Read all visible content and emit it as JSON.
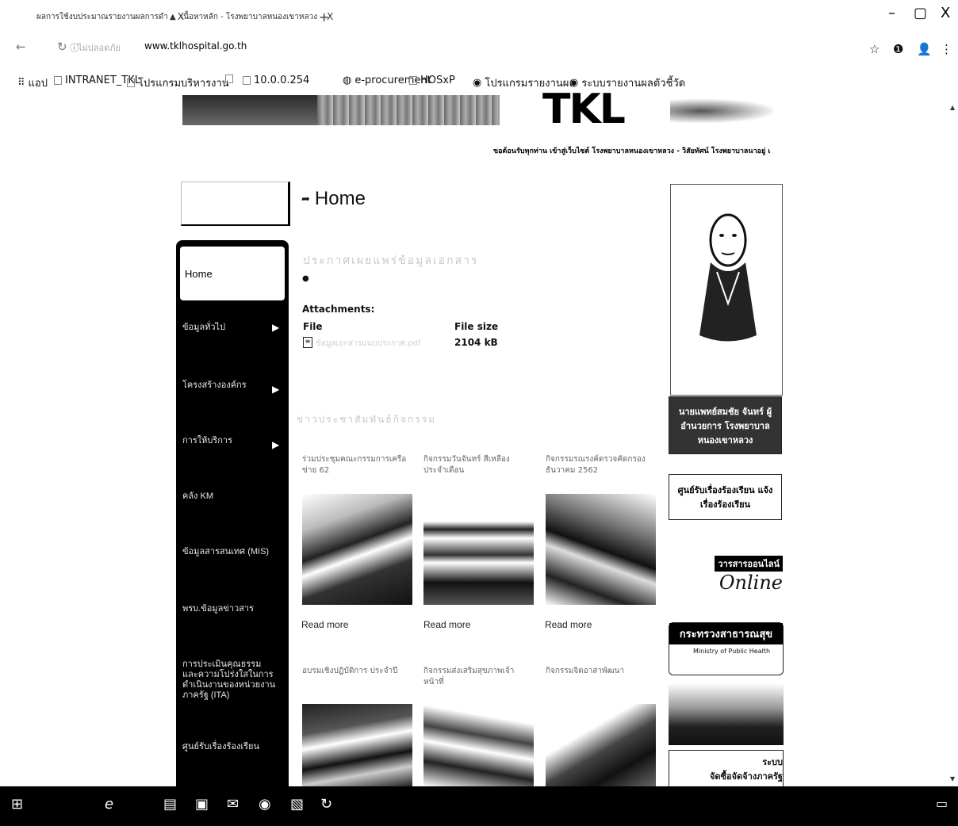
{
  "browser": {
    "tabs": [
      {
        "title": "ผลการใช้งบประมาณรายงานผลการดำ"
      },
      {
        "title": "เนื้อหาหลัก - โรงพยาบาลหนองเขาหลวง"
      }
    ],
    "new_tab_label": "+",
    "close_label": "X",
    "window": {
      "minimize": "–",
      "maximize": "▢",
      "close": "X"
    },
    "url_prefix": "ไม่ปลอดภัย",
    "url": "www.tklhospital.go.th",
    "bookmarks": [
      "แอป",
      "INTRANET_TKL",
      "โปรแกรมบริหารงาน",
      "",
      "10.0.0.254",
      "e-procurement",
      "HOSxP",
      "โปรแกรมรายงานผล",
      "ระบบรายงานผลตัวชี้วัด"
    ],
    "icons": {
      "star": "☆",
      "extension": "❶",
      "profile": "👤",
      "menu": "⋮"
    }
  },
  "header": {
    "logo_letters": "TKL",
    "marquee": "ขอต้อนรับทุกท่าน เข้าสู่เว็บไซต์ โรงพยาบาลหนองเขาหลวง - วิสัยทัศน์ โรงพยาบาลนาอยู่ เ"
  },
  "sidebar": {
    "active": "Home",
    "items": [
      {
        "label": "ข้อมูลทั่วไป",
        "arrow": true
      },
      {
        "label": "โครงสร้างองค์กร",
        "arrow": true
      },
      {
        "label": "การให้บริการ",
        "arrow": true
      },
      {
        "label": "คลัง KM",
        "arrow": false
      },
      {
        "label": "ข้อมูลสารสนเทศ (MIS)",
        "arrow": false
      },
      {
        "label": "พรบ.ข้อมูลข่าวสาร",
        "arrow": false
      },
      {
        "label": "การประเมินคุณธรรมและความโปร่งใสในการดำเนินงานของหน่วยงานภาครัฐ (ITA)",
        "arrow": false
      },
      {
        "label": "ศูนย์รับเรื่องร้องเรียน",
        "arrow": false
      }
    ]
  },
  "content": {
    "page_title": "Home",
    "faint_heading": "ประกาศเผยแพร่ข้อมูลเอกสาร",
    "attachments": {
      "heading": "Attachments:",
      "col_file": "File",
      "col_size": "File size",
      "file_name": "ข้อมูลเอกสารแนบประกาศ.pdf",
      "file_size": "2104 kB"
    },
    "faint_sub": "ข่าวประชาสัมพันธ์กิจกรรม",
    "news": [
      {
        "caption": "ร่วมประชุมคณะกรรมการเครือข่าย 62",
        "read_more": "Read more"
      },
      {
        "caption": "กิจกรรมวันจันทร์ สีเหลือง ประจำเดือน",
        "read_more": "Read more"
      },
      {
        "caption": "กิจกรรมรณรงค์ตรวจคัดกรอง ธันวาคม 2562",
        "read_more": "Read more"
      },
      {
        "caption": "อบรมเชิงปฏิบัติการ ประจำปี",
        "read_more": ""
      },
      {
        "caption": "กิจกรรมส่งเสริมสุขภาพเจ้าหน้าที่",
        "read_more": ""
      },
      {
        "caption": "กิจกรรมจิตอาสาพัฒนา",
        "read_more": ""
      }
    ]
  },
  "right": {
    "director_caption": "นายแพทย์สมชัย จันทร์ ผู้อำนวยการ โรงพยาบาลหนองเขาหลวง",
    "ad1": "ศูนย์รับเรื่องร้องเรียน แจ้งเรื่องร้องเรียน",
    "ad2_top": "วารสารออนไลน์",
    "ad2_bottom": "Online",
    "moph_th": "กระทรวงสาธารณสุข",
    "moph_en": "Ministry of Public Health",
    "ad4_line1": "ระบบ",
    "ad4_line2": "จัดซื้อจัดจ้างภาครัฐ"
  },
  "taskbar": {
    "icons": [
      "windows-icon",
      "ie-icon",
      "file-explorer-icon",
      "store-icon",
      "mail-icon",
      "chrome-icon",
      "document-icon",
      "app-icon"
    ]
  }
}
